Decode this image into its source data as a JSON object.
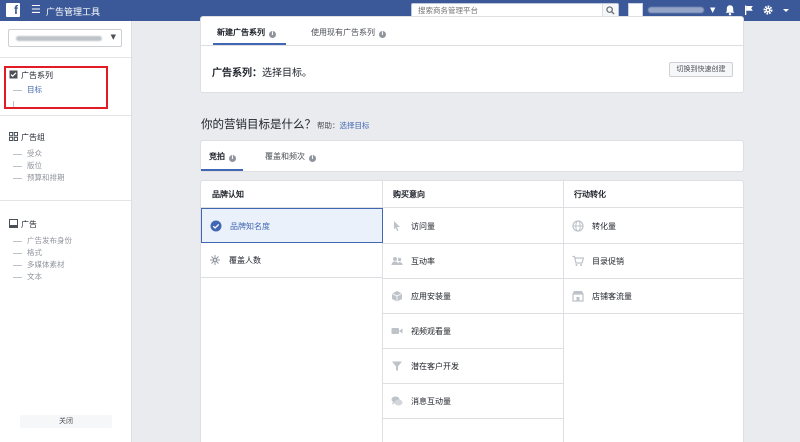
{
  "topbar": {
    "logo": "f",
    "menu_icon": "hamburger-icon",
    "title": "广告管理工具",
    "search_placeholder": "搜索商务管理平台",
    "brand_color": "#3b5998"
  },
  "sidebar": {
    "campaign": {
      "label": "广告系列",
      "items": [
        "目标"
      ]
    },
    "adset": {
      "label": "广告组",
      "items": [
        "受众",
        "版位",
        "预算和排期"
      ]
    },
    "ad": {
      "label": "广告",
      "items": [
        "广告发布身份",
        "格式",
        "多媒体素材",
        "文本"
      ]
    },
    "close_label": "关闭",
    "highlight_color": "#e21b24"
  },
  "campaign_card": {
    "tabs": [
      {
        "label": "新建广告系列",
        "active": true
      },
      {
        "label": "使用现有广告系列",
        "active": false
      }
    ],
    "heading": "广告系列：",
    "heading_hint": "选择目标。",
    "quick_create_label": "切换到快速创建"
  },
  "objective": {
    "question": "你的营销目标是什么？",
    "help_prefix": "帮助：",
    "help_link": "选择目标",
    "tabs": [
      {
        "label": "竞拍",
        "active": true
      },
      {
        "label": "覆盖和频次",
        "active": false
      }
    ],
    "columns": [
      {
        "header": "品牌认知",
        "items": [
          {
            "label": "品牌知名度",
            "icon": "check-circle-icon",
            "selected": true
          },
          {
            "label": "覆盖人数",
            "icon": "asterisk-icon",
            "selected": false
          }
        ]
      },
      {
        "header": "购买意向",
        "items": [
          {
            "label": "访问量",
            "icon": "cursor-icon"
          },
          {
            "label": "互动率",
            "icon": "people-icon"
          },
          {
            "label": "应用安装量",
            "icon": "box-icon"
          },
          {
            "label": "视频观看量",
            "icon": "video-camera-icon"
          },
          {
            "label": "潜在客户开发",
            "icon": "funnel-icon"
          },
          {
            "label": "消息互动量",
            "icon": "chat-bubbles-icon"
          }
        ]
      },
      {
        "header": "行动转化",
        "items": [
          {
            "label": "转化量",
            "icon": "globe-icon"
          },
          {
            "label": "目录促销",
            "icon": "shopping-cart-icon"
          },
          {
            "label": "店铺客流量",
            "icon": "store-icon"
          }
        ]
      }
    ],
    "accent_color": "#4267b2"
  }
}
